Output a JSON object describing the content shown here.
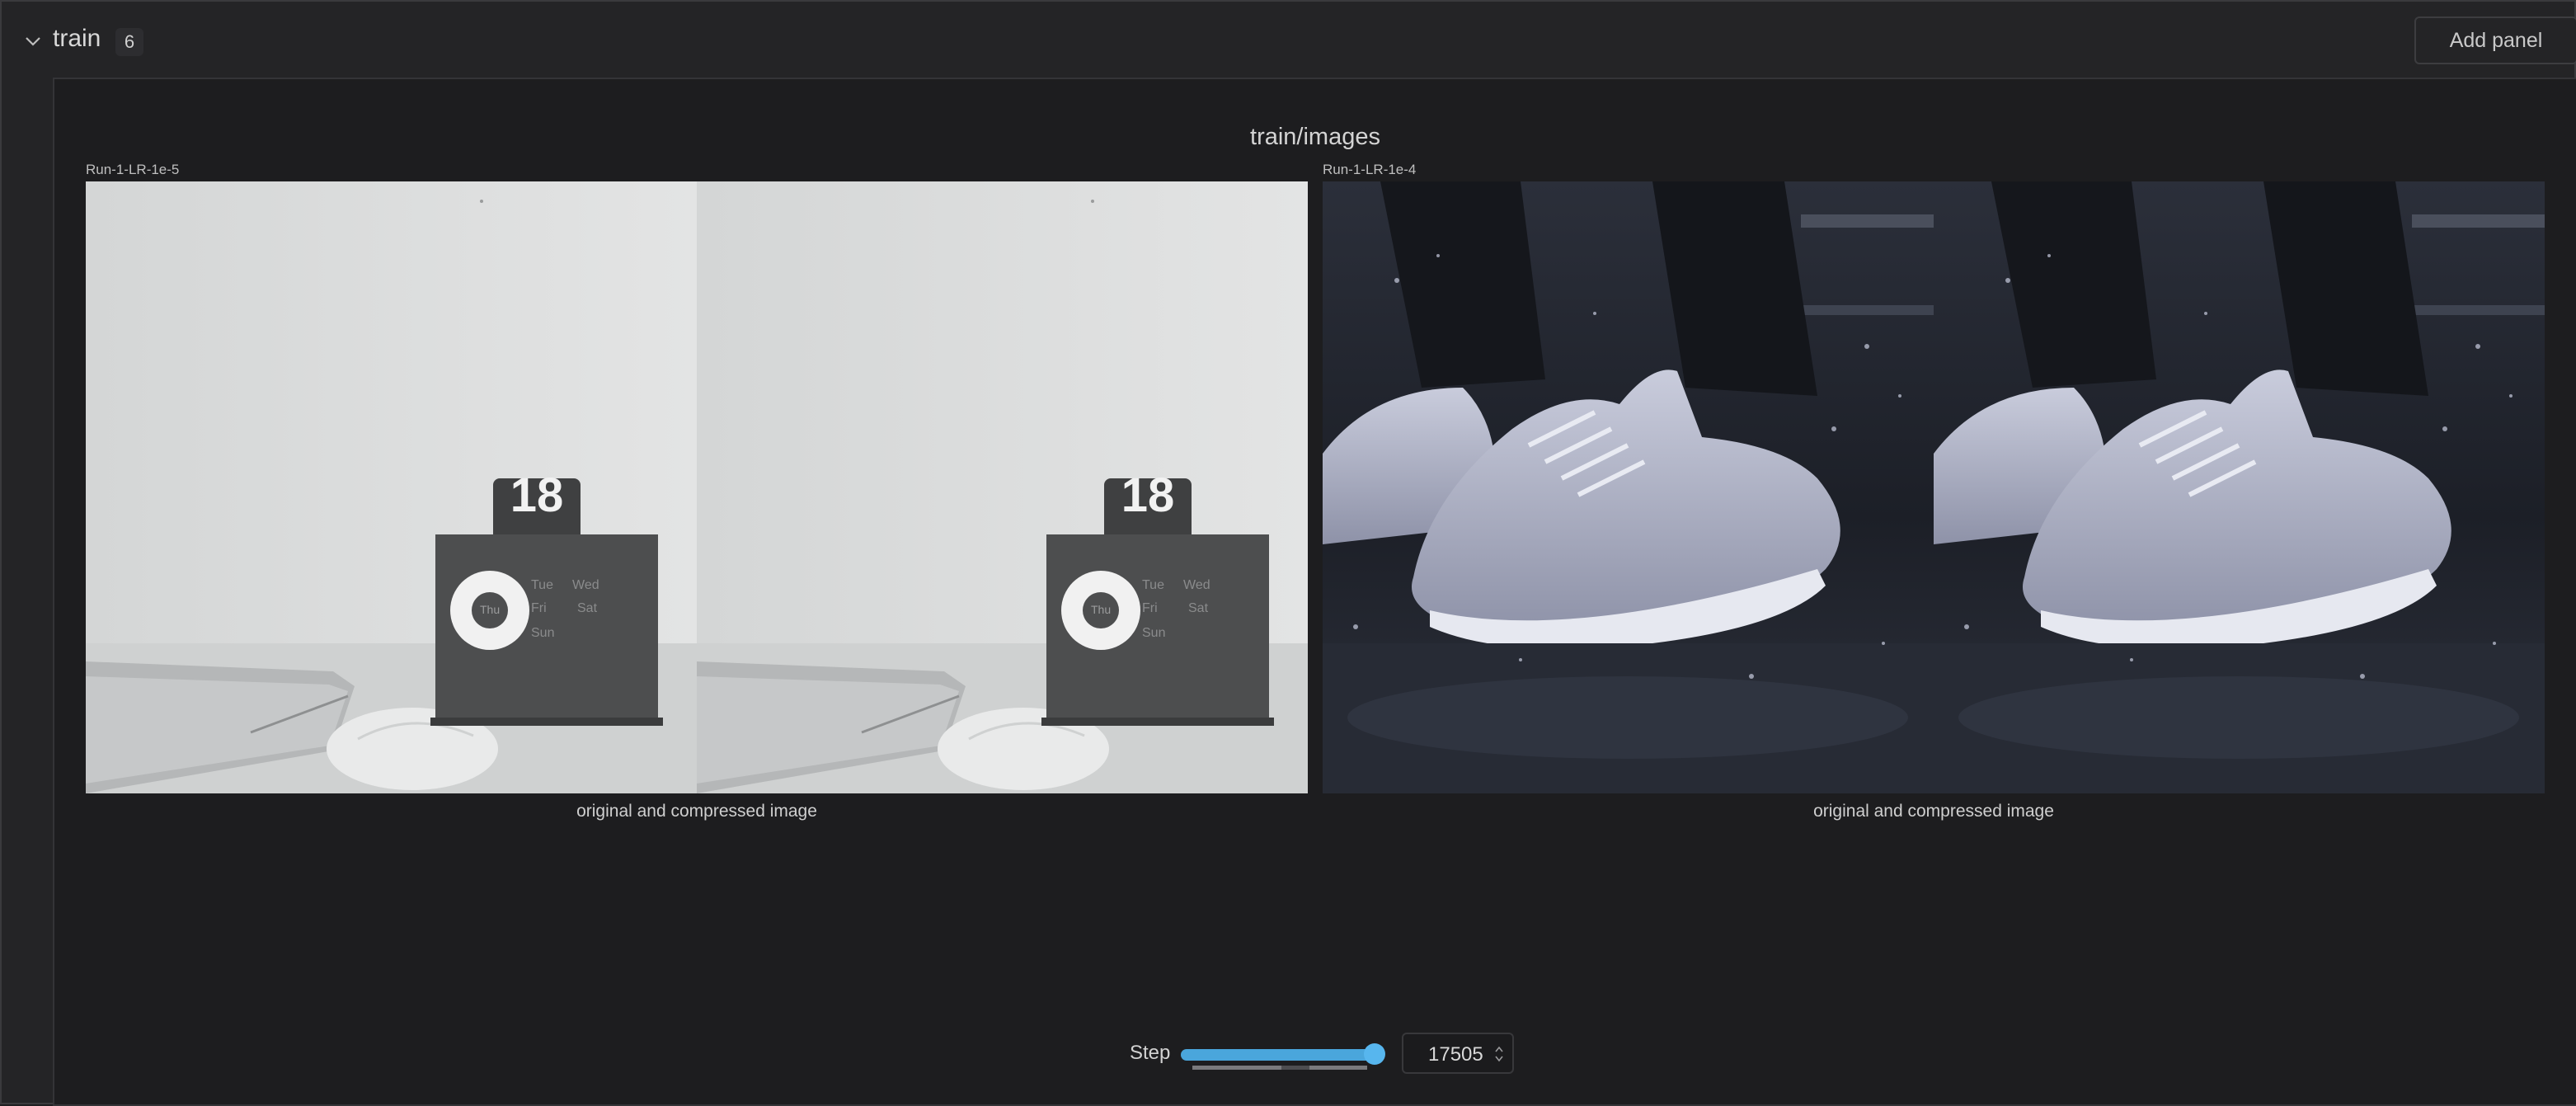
{
  "section": {
    "title": "train",
    "count": "6",
    "add_panel_label": "Add panel"
  },
  "panel": {
    "title": "train/images",
    "runs": [
      {
        "name": "Run-1-LR-1e-5",
        "caption": "original and compressed image",
        "image_subject": "desk-calendar-laptop-photo",
        "calendar_number": "18",
        "calendar_days": [
          "Tue",
          "Wed",
          "Thu",
          "Fri",
          "Sat",
          "Sun"
        ]
      },
      {
        "name": "Run-1-LR-1e-4",
        "caption": "original and compressed image",
        "image_subject": "white-sneakers-splash-photo"
      }
    ]
  },
  "step_control": {
    "label": "Step",
    "value": "17505",
    "slider_fraction": 1.0
  },
  "icons": {
    "collapse": "chevron-down-icon",
    "spinner": "stepper-arrows-icon"
  },
  "colors": {
    "background": "#1f1f21",
    "panel_background": "#1d1d1f",
    "accent": "#57b6ee"
  }
}
